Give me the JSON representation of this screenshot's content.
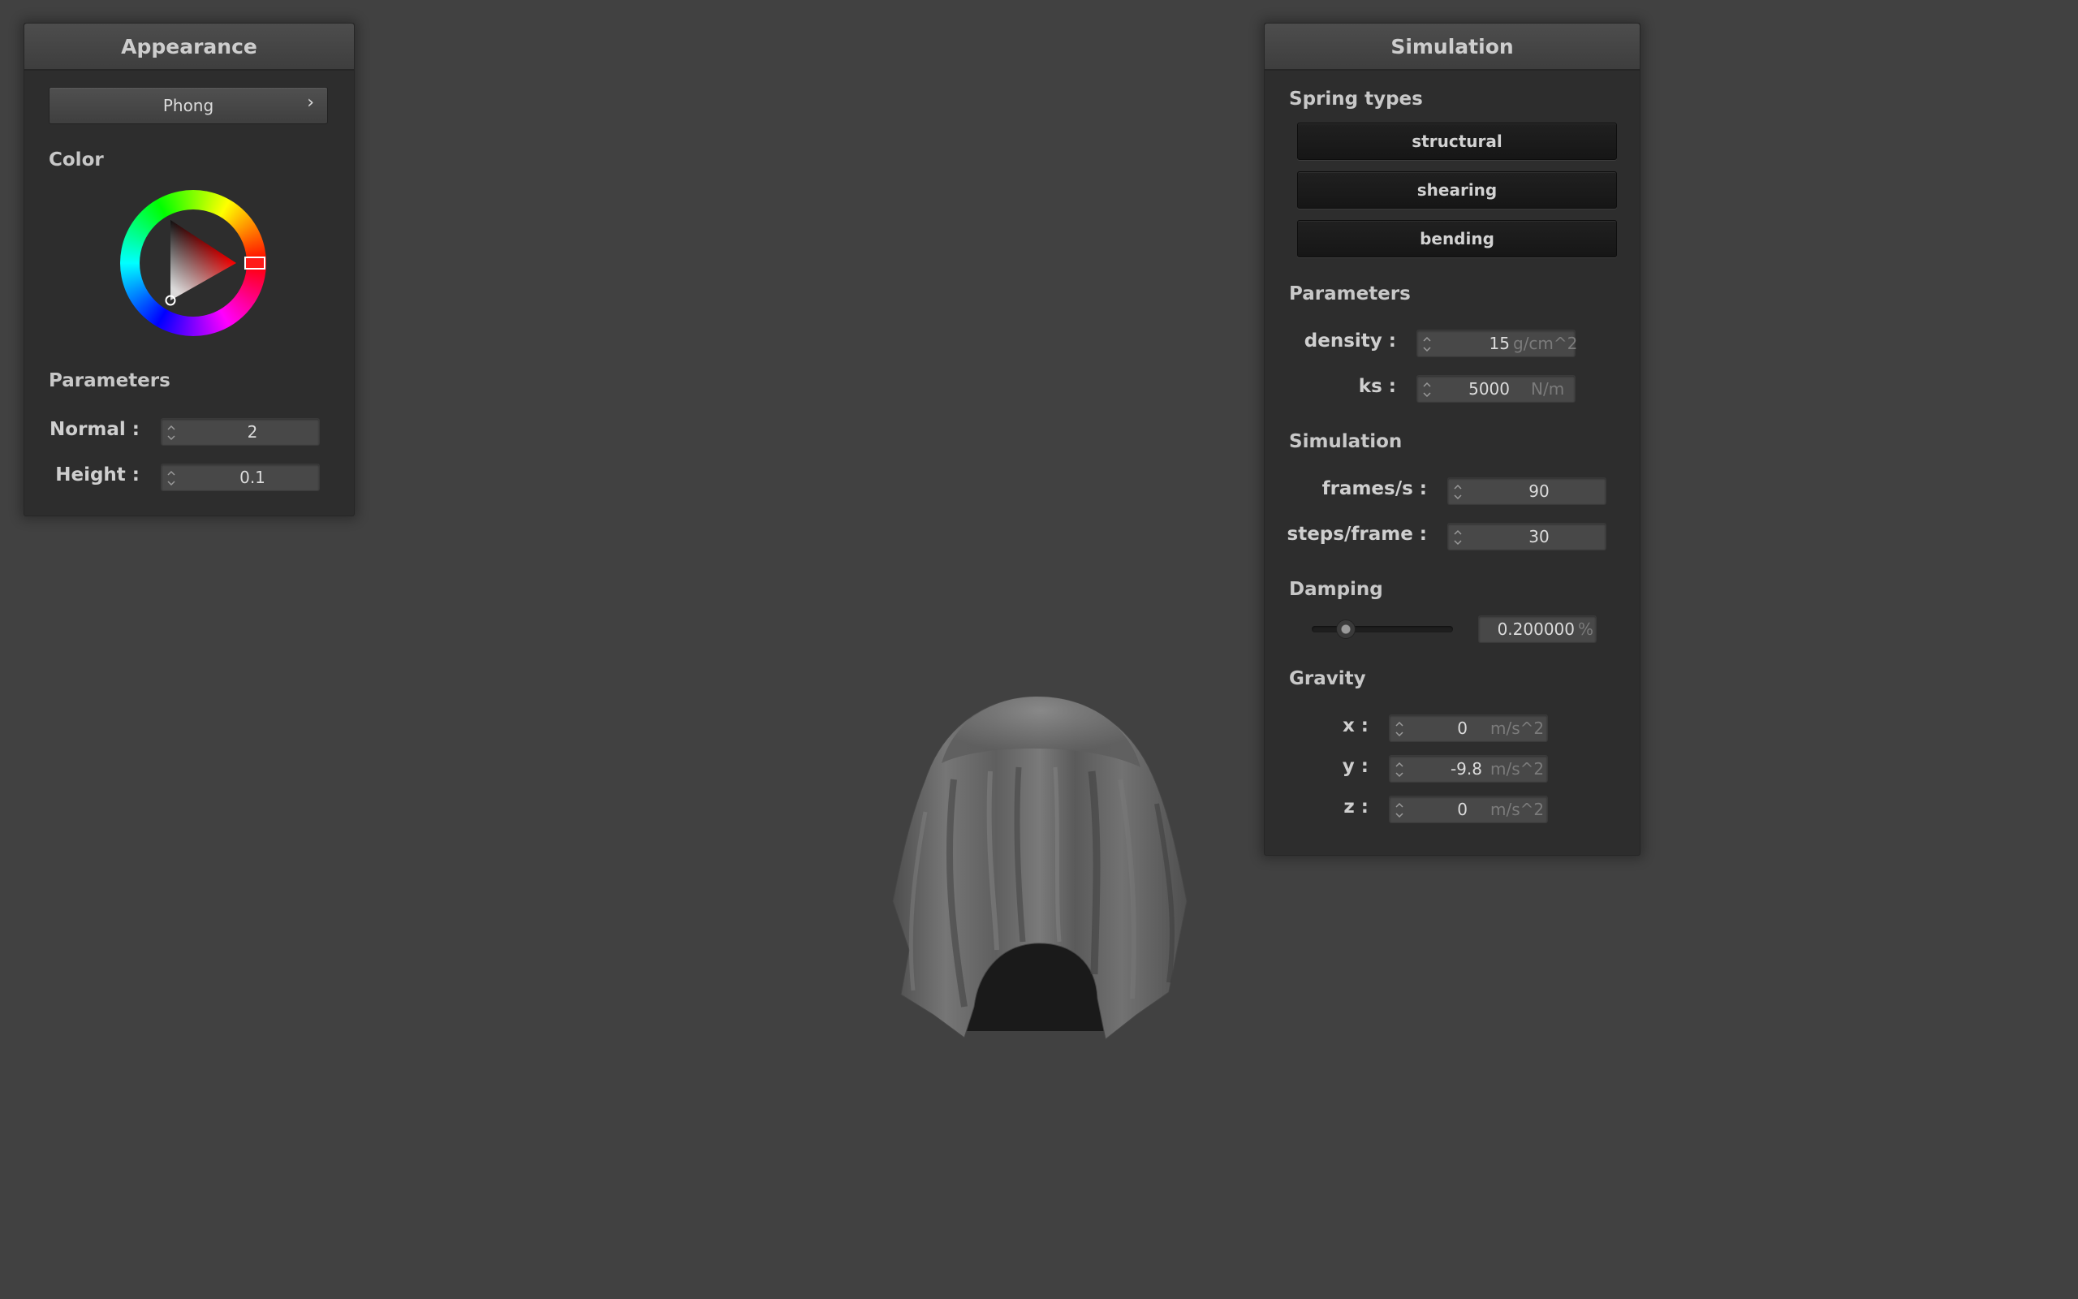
{
  "appearance": {
    "title": "Appearance",
    "shader_label": "Phong",
    "shader_arrow": "›",
    "color_label": "Color",
    "color_wheel": {
      "selected_hue": "#ff0000"
    },
    "parameters_label": "Parameters",
    "normal": {
      "label": "Normal :",
      "value": "2"
    },
    "height": {
      "label": "Height :",
      "value": "0.1"
    }
  },
  "simulation": {
    "title": "Simulation",
    "spring_types_label": "Spring types",
    "spring_buttons": [
      "structural",
      "shearing",
      "bending"
    ],
    "parameters_label": "Parameters",
    "density": {
      "label": "density :",
      "value": "15",
      "unit": "g/cm^2"
    },
    "ks": {
      "label": "ks :",
      "value": "5000",
      "unit": "N/m"
    },
    "sim_label": "Simulation",
    "frames": {
      "label": "frames/s :",
      "value": "90"
    },
    "steps": {
      "label": "steps/frame :",
      "value": "30"
    },
    "damping_label": "Damping",
    "damping": {
      "slider_fraction": 0.2,
      "value": "0.200000",
      "unit": "%"
    },
    "gravity_label": "Gravity",
    "gx": {
      "label": "x :",
      "value": "0",
      "unit": "m/s^2"
    },
    "gy": {
      "label": "y :",
      "value": "-9.8",
      "unit": "m/s^2"
    },
    "gz": {
      "label": "z :",
      "value": "0",
      "unit": "m/s^2"
    }
  },
  "icons": {
    "spinner": "spinner-icon",
    "chevron": "chevron-right-icon",
    "color_wheel": "color-wheel-icon",
    "cloth": "cloth-mesh"
  },
  "colors": {
    "viewport_bg": "#414141",
    "panel_bg": "#2d2d2d",
    "cloth": "#6b6b6b"
  }
}
